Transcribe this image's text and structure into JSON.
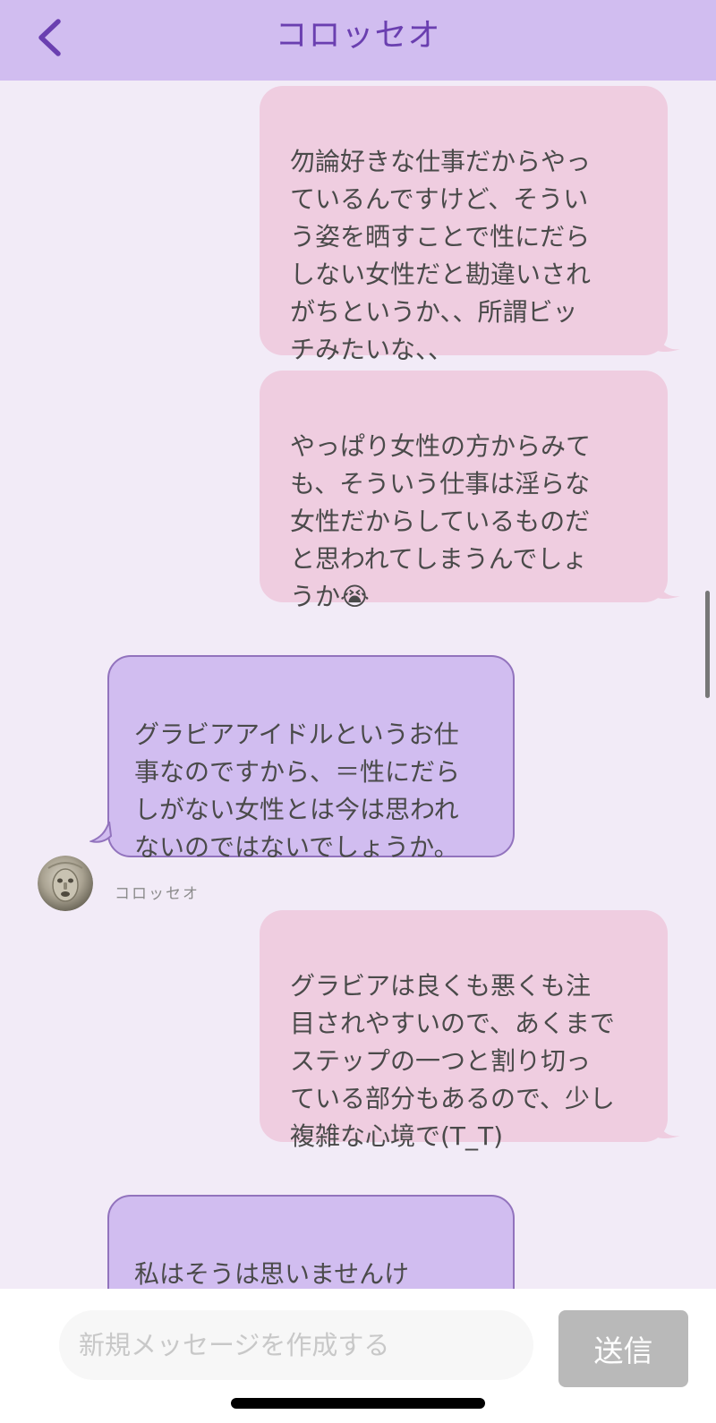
{
  "header": {
    "title": "コロッセオ",
    "back_icon": "chevron-left-icon"
  },
  "messages": [
    {
      "side": "sent",
      "text": "勿論好きな仕事だからやっ\nているんですけど、そうい\nう姿を晒すことで性にだら\nしない女性だと勘違いされ\nがちというか、、所謂ビッ\nチみたいな、、"
    },
    {
      "side": "sent",
      "text": "やっぱり女性の方からみて\nも、そういう仕事は淫らな\n女性だからしているものだ\nと思われてしまうんでしょ\nうか",
      "emoji": "😭"
    },
    {
      "side": "received",
      "text": "グラビアアイドルというお仕\n事なのですから、＝性にだら\nしがない女性とは今は思われ\nないのではないでしょうか。"
    },
    {
      "side": "sent",
      "text": "グラビアは良くも悪くも注\n目されやすいので、あくまで\nステップの一つと割り切っ\nている部分もあるので、少し\n複雑な心境で(T_T)"
    },
    {
      "side": "received",
      "text": "私はそうは思いませんけ\nど"
    }
  ],
  "sender": {
    "name": "コロッセオ"
  },
  "composer": {
    "placeholder": "新規メッセージを作成する",
    "value": "",
    "send_label": "送信"
  },
  "colors": {
    "header_bg": "#d1bdf0",
    "title": "#6a3fb0",
    "background": "#f2ebf7",
    "sent_bubble": "#efcde0",
    "received_bubble": "#d1bdf0",
    "received_border": "#9273bd",
    "send_button": "#b9b9b9"
  }
}
